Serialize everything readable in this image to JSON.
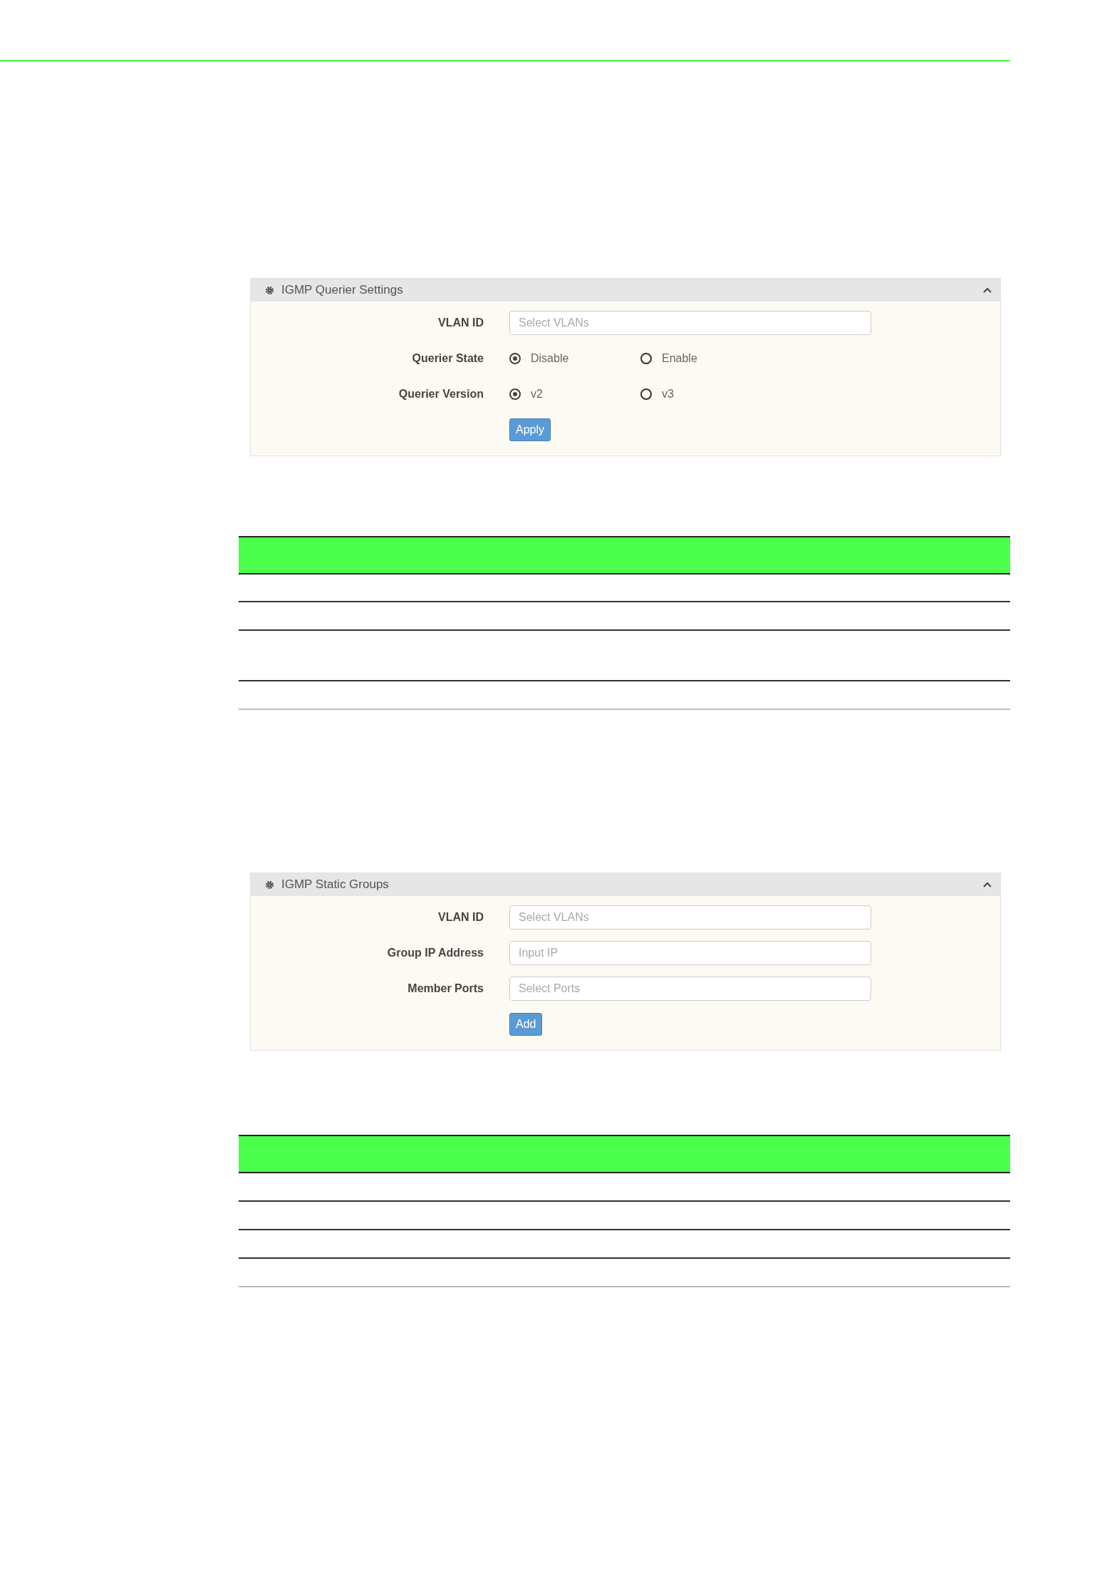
{
  "panels": [
    {
      "title": "IGMP Querier Settings",
      "expanded": true,
      "rows": [
        {
          "kind": "input",
          "label": "VLAN ID",
          "placeholder": "Select VLANs"
        },
        {
          "kind": "radio",
          "label": "Querier State",
          "options": [
            {
              "label": "Disable",
              "selected": true
            },
            {
              "label": "Enable",
              "selected": false
            }
          ]
        },
        {
          "kind": "radio",
          "label": "Querier Version",
          "options": [
            {
              "label": "v2",
              "selected": true
            },
            {
              "label": "v3",
              "selected": false
            }
          ]
        },
        {
          "kind": "button",
          "text": "Apply"
        }
      ]
    },
    {
      "title": "IGMP Static Groups",
      "expanded": true,
      "rows": [
        {
          "kind": "input",
          "label": "VLAN ID",
          "placeholder": "Select VLANs"
        },
        {
          "kind": "input",
          "label": "Group IP Address",
          "placeholder": "Input IP"
        },
        {
          "kind": "input",
          "label": "Member Ports",
          "placeholder": "Select Ports"
        },
        {
          "kind": "button",
          "text": "Add"
        }
      ]
    }
  ]
}
